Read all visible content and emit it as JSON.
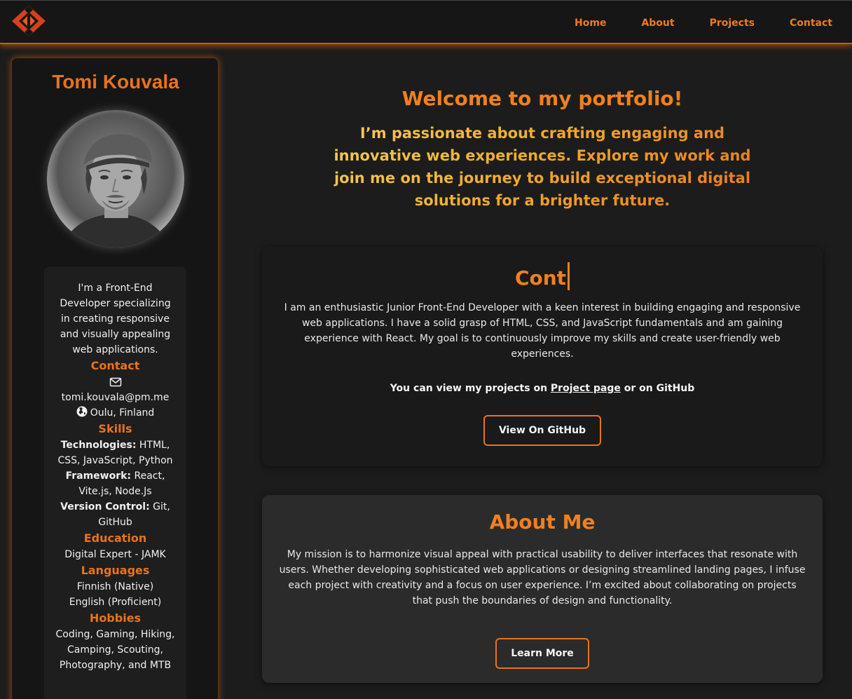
{
  "nav": {
    "logo_icon": "diamond-logo-icon",
    "links": [
      "Home",
      "About",
      "Projects",
      "Contact"
    ]
  },
  "sidebar": {
    "name": "Tomi Kouvala",
    "intro": "I'm a Front-End Developer specializing in creating responsive and visually appealing web applications.",
    "contact": {
      "heading": "Contact",
      "email": "tomi.kouvala@pm.me",
      "location": "Oulu, Finland"
    },
    "skills": {
      "heading": "Skills",
      "tech_label": "Technologies:",
      "tech_value": " HTML, CSS, JavaScript, Python",
      "framework_label": "Framework:",
      "framework_value": " React, Vite.js, Node.Js",
      "vc_label": "Version Control:",
      "vc_value": " Git, GitHub"
    },
    "education": {
      "heading": "Education",
      "value": "Digital Expert - JAMK"
    },
    "languages": {
      "heading": "Languages",
      "items": [
        "Finnish (Native)",
        "English (Proficient)"
      ]
    },
    "hobbies": {
      "heading": "Hobbies",
      "value": "Coding, Gaming, Hiking, Camping, Scouting, Photography, and MTB"
    }
  },
  "hero": {
    "title": "Welcome to my portfolio!",
    "subtitle": "I’m passionate about crafting engaging and innovative web experiences. Explore my work and join me on the journey to build exceptional digital solutions for a brighter future."
  },
  "intro_card": {
    "title": "Cont",
    "text": "I am an enthusiastic Junior Front-End Developer with a keen interest in building engaging and responsive web applications. I have a solid grasp of HTML, CSS, and JavaScript fundamentals and am gaining experience with React. My goal is to continuously improve my skills and create user-friendly web experiences.",
    "projects_prefix": "You can view my projects on ",
    "projects_link": "Project page",
    "projects_suffix": " or on GitHub",
    "button": "View On GitHub"
  },
  "about_card": {
    "title": "About Me",
    "text": "My mission is to harmonize visual appeal with practical usability to deliver interfaces that resonate with users. Whether developing sophisticated web applications or designing streamlined landing pages, I infuse each project with creativity and a focus on user experience. I’m excited about collaborating on projects that push the boundaries of design and functionality.",
    "button": "Learn More"
  },
  "colors": {
    "accent": "#e8731c",
    "background": "#1c1c1c",
    "card": "#2b2b2b"
  }
}
